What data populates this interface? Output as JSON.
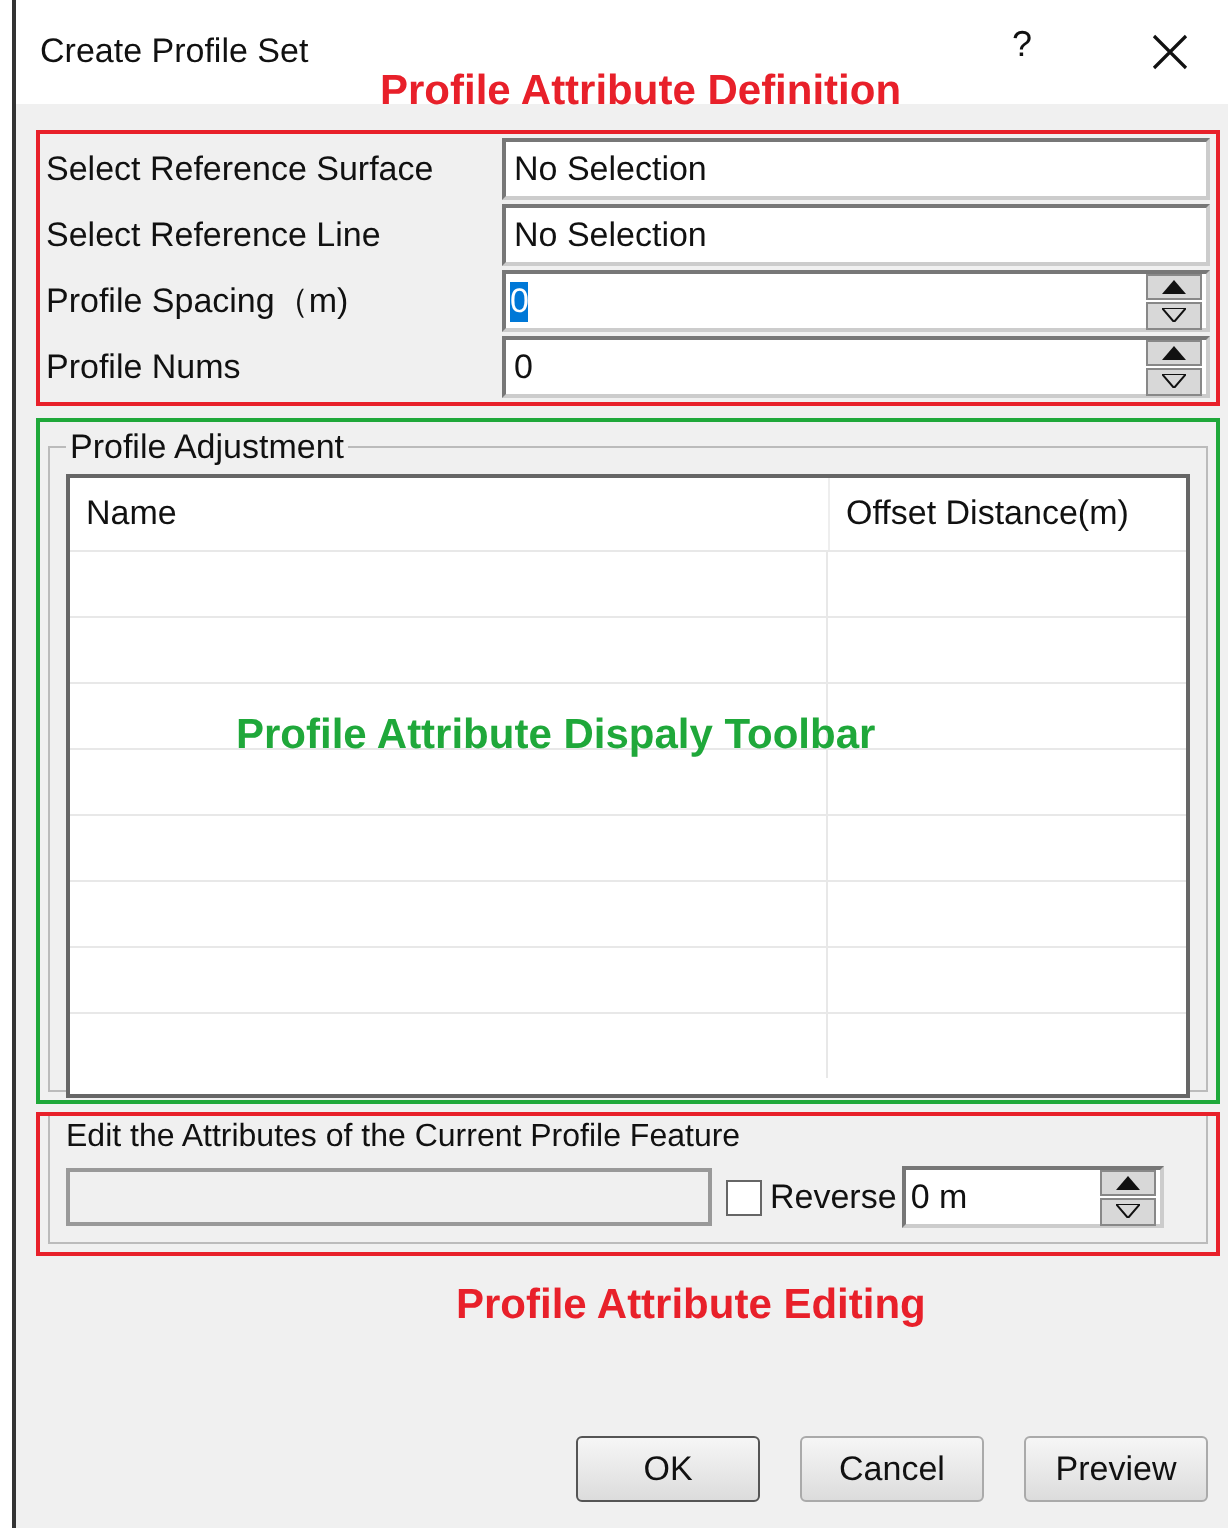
{
  "window": {
    "title": "Create Profile Set",
    "help": "?"
  },
  "definition": {
    "rows": [
      {
        "label": "Select Reference Surface",
        "value": "No Selection",
        "kind": "text",
        "selected_text": false
      },
      {
        "label": "Select Reference Line",
        "value": "No Selection",
        "kind": "text",
        "selected_text": false
      },
      {
        "label": "Profile Spacing（m)",
        "value": "0",
        "kind": "spin",
        "selected_text": true
      },
      {
        "label": "Profile Nums",
        "value": "0",
        "kind": "spin",
        "selected_text": false
      }
    ]
  },
  "adjustment": {
    "title": "Profile Adjustment",
    "table": {
      "columns": [
        "Name",
        "Offset Distance(m)"
      ]
    }
  },
  "editing": {
    "title": "Edit the Attributes of the Current Profile Feature",
    "reverse": {
      "label": "Reverse",
      "checked": false
    },
    "offset": {
      "value": "0 m"
    }
  },
  "buttons": [
    "OK",
    "Cancel",
    "Preview"
  ],
  "annotations": [
    {
      "label": "Profile Attribute Definition",
      "color": "#e8202a"
    },
    {
      "label": "Profile Attribute Dispaly Toolbar",
      "color": "#1fa83a"
    },
    {
      "label": "Profile Attribute Editing",
      "color": "#e8202a"
    }
  ]
}
